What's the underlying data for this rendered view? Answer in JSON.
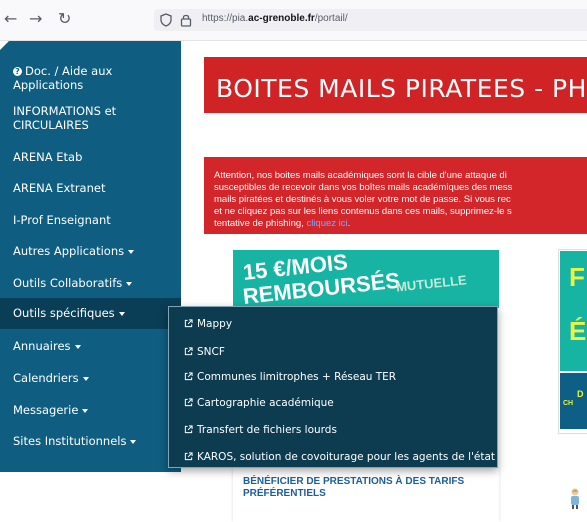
{
  "browser": {
    "url_prefix": "https://pia.",
    "url_domain": "ac-grenoble.fr",
    "url_path": "/portail/",
    "back_icon": "arrow-left-icon",
    "forward_icon": "arrow-right-icon",
    "reload_icon": "reload-icon",
    "shield_icon": "shield-icon",
    "lock_icon": "lock-icon"
  },
  "sidebar": {
    "items": [
      {
        "label": "Doc. / Aide aux",
        "label2": "Applications"
      },
      {
        "label": "INFORMATIONS et",
        "label2": "CIRCULAIRES"
      },
      {
        "label": "ARENA Etab"
      },
      {
        "label": "ARENA Extranet"
      },
      {
        "label": "I-Prof Enseignant"
      },
      {
        "label": "Autres Applications"
      },
      {
        "label": "Outils Collaboratifs"
      },
      {
        "label": "Outils spécifiques"
      },
      {
        "label": "Annuaires"
      },
      {
        "label": "Calendriers"
      },
      {
        "label": "Messagerie"
      },
      {
        "label": "Sites Institutionnels"
      }
    ],
    "colors": {
      "background": "#0f5d80",
      "active": "#0a3e57"
    }
  },
  "banner": {
    "title": "BOITES MAILS PIRATEES - PH",
    "color": "#cf2326"
  },
  "alert": {
    "lines": [
      "Attention, nos boites mails académiques sont la cible d'une attaque di",
      "susceptibles de recevoir dans vos boîtes mails académiques des mess",
      "mails piratées et destinés à vous voler votre mot de passe. Si vous rec",
      "et ne cliquez pas sur les liens contenus dans ces mails, supprimez-le s",
      "tentative de phishing,"
    ],
    "link": "cliquez ici",
    "end": "."
  },
  "promo": {
    "line1": "15 €/MOIS",
    "line2": "REMBOURSÉS",
    "faint": "MUTUELLE"
  },
  "right_card": {
    "l1": "F",
    "l2": "É",
    "l3": "D",
    "l4": "CH"
  },
  "bottom_card": {
    "line1": "BÉNÉFICIER DE PRESTATIONS À DES TARIFS",
    "line2": "PRÉFÉRENTIELS"
  },
  "dropdown": {
    "items": [
      {
        "label": "Mappy"
      },
      {
        "label": "SNCF"
      },
      {
        "label": "Communes limitrophes + Réseau TER"
      },
      {
        "label": "Cartographie académique"
      },
      {
        "label": "Transfert de fichiers lourds"
      },
      {
        "label": "KAROS, solution de covoiturage pour les agents de l'état"
      }
    ]
  }
}
